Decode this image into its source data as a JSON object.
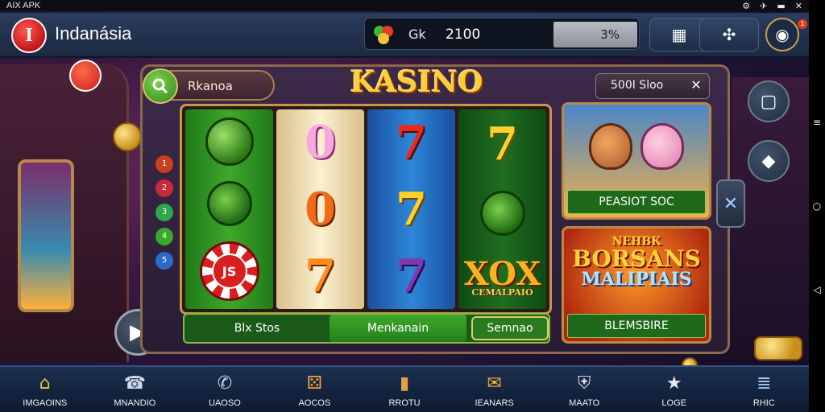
{
  "statusbar": {
    "app_label": "AIX APK",
    "icons": [
      "⚙",
      "✈",
      "▬",
      "✕"
    ]
  },
  "header": {
    "logo_glyph": "I",
    "brand": "Indanásia",
    "balance": {
      "label": "Gk",
      "value": "2100",
      "bar_text": "3%"
    },
    "buttons": [
      {
        "name": "gift-icon",
        "glyph": "▦"
      },
      {
        "name": "share-icon",
        "glyph": "✣"
      }
    ],
    "profile_glyph": "◉",
    "notif_count": "1"
  },
  "panel": {
    "search_label": "Rkanoa",
    "title": "KASINO",
    "slot_chip": {
      "label": "500I Sloo",
      "close": "✕"
    },
    "reels": [
      {
        "color": "green",
        "symbols": [
          "bomb",
          "leaf",
          "chip"
        ]
      },
      {
        "color": "cream",
        "symbols": [
          "0",
          "0",
          "7"
        ]
      },
      {
        "color": "blue",
        "symbols": [
          "7",
          "7",
          "7"
        ]
      },
      {
        "color": "dgreen",
        "symbols": [
          "7",
          "leaf",
          "xox"
        ]
      }
    ],
    "chip_text": "JS",
    "xox": {
      "big": "XOX",
      "small": "CEMALPAIO"
    },
    "line_dots": [
      "1",
      "2",
      "3",
      "4",
      "5"
    ],
    "action_bar": {
      "bet": "Blx Stos",
      "middle": "Menkanain",
      "spin": "Semnao"
    },
    "promos": [
      {
        "label": "PEASIOT SOC"
      },
      {
        "headline_1": "NEHBK",
        "headline_2": "BORSANS",
        "headline_3": "MALIPIAIS",
        "label": "BLEMSBIRE"
      }
    ],
    "arrow_glyph": "✕"
  },
  "side_buttons": [
    {
      "name": "share-side-icon",
      "glyph": "▢"
    },
    {
      "name": "arrows-icon",
      "glyph": "◆"
    }
  ],
  "play_glyph": "▶",
  "bottom_nav": [
    {
      "icon": "home-icon",
      "glyph": "⌂",
      "label": "IMGAOINS",
      "color": "#f2c23a"
    },
    {
      "icon": "phone-icon",
      "glyph": "☎",
      "label": "MNANDIO",
      "color": "#cfd8e8"
    },
    {
      "icon": "chat-icon",
      "glyph": "✆",
      "label": "UAOSO",
      "color": "#cfd8e8"
    },
    {
      "icon": "dice-icon",
      "glyph": "⚄",
      "label": "AOCOS",
      "color": "#f2a23a"
    },
    {
      "icon": "bag-icon",
      "glyph": "▮",
      "label": "RROTU",
      "color": "#e0a04a"
    },
    {
      "icon": "gift-box-icon",
      "glyph": "✉",
      "label": "IEANARS",
      "color": "#f2b23a"
    },
    {
      "icon": "shield-icon",
      "glyph": "⛨",
      "label": "MAATO",
      "color": "#cfd8e8"
    },
    {
      "icon": "star-icon",
      "glyph": "★",
      "label": "LOGE",
      "color": "#e8e8f0"
    },
    {
      "icon": "list-icon",
      "glyph": "≣",
      "label": "RHIC",
      "color": "#9fc8ff"
    }
  ],
  "android_nav": [
    "≡",
    "○",
    "◁"
  ]
}
